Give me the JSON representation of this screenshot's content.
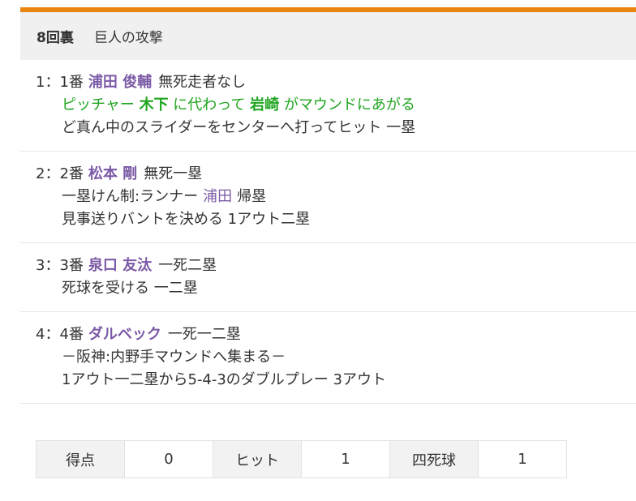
{
  "inning": {
    "label": "8回裏",
    "team_attack": "巨人の攻撃"
  },
  "at_bats": [
    {
      "num": "1：1番",
      "player": "浦田 俊輔",
      "situation": "無死走者なし",
      "change": {
        "prefix": "ピッチャー",
        "from": "木下",
        "mid": "に代わって",
        "to": "岩崎",
        "suffix": "がマウンドにあがる"
      },
      "result": "ど真ん中のスライダーをセンターへ打ってヒット 一塁"
    },
    {
      "num": "2：2番",
      "player": "松本 剛",
      "situation": "無死一塁",
      "event": {
        "prefix": "一塁けん制:ランナー",
        "runner": "浦田",
        "suffix": "帰塁"
      },
      "result": "見事送りバントを決める 1アウト二塁"
    },
    {
      "num": "3：3番",
      "player": "泉口 友汰",
      "situation": "一死二塁",
      "result": "死球を受ける 一二塁"
    },
    {
      "num": "4：4番",
      "player": "ダルベック",
      "situation": "一死一二塁",
      "note": "－阪神:内野手マウンドへ集まる－",
      "result": "1アウト一二塁から5-4-3のダブルプレー 3アウト"
    }
  ],
  "summary": {
    "runs_label": "得点",
    "runs": "0",
    "hits_label": "ヒット",
    "hits": "1",
    "walks_label": "四死球",
    "walks": "1"
  },
  "colors": {
    "accent": "#e8840f",
    "player": "#7b5aa6",
    "change": "#1fa51f"
  }
}
